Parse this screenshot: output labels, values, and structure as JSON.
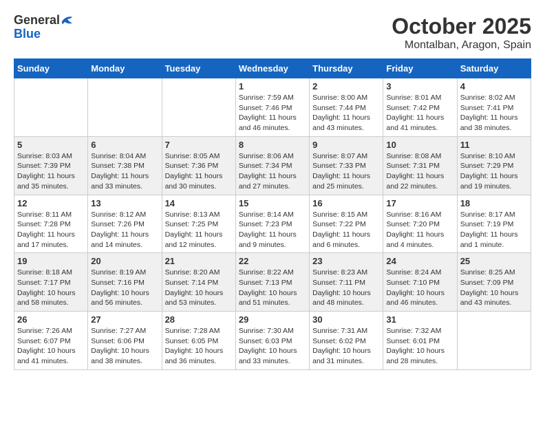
{
  "header": {
    "logo_line1": "General",
    "logo_line2": "Blue",
    "month": "October 2025",
    "location": "Montalban, Aragon, Spain"
  },
  "weekdays": [
    "Sunday",
    "Monday",
    "Tuesday",
    "Wednesday",
    "Thursday",
    "Friday",
    "Saturday"
  ],
  "weeks": [
    [
      {
        "day": "",
        "info": ""
      },
      {
        "day": "",
        "info": ""
      },
      {
        "day": "",
        "info": ""
      },
      {
        "day": "1",
        "info": "Sunrise: 7:59 AM\nSunset: 7:46 PM\nDaylight: 11 hours\nand 46 minutes."
      },
      {
        "day": "2",
        "info": "Sunrise: 8:00 AM\nSunset: 7:44 PM\nDaylight: 11 hours\nand 43 minutes."
      },
      {
        "day": "3",
        "info": "Sunrise: 8:01 AM\nSunset: 7:42 PM\nDaylight: 11 hours\nand 41 minutes."
      },
      {
        "day": "4",
        "info": "Sunrise: 8:02 AM\nSunset: 7:41 PM\nDaylight: 11 hours\nand 38 minutes."
      }
    ],
    [
      {
        "day": "5",
        "info": "Sunrise: 8:03 AM\nSunset: 7:39 PM\nDaylight: 11 hours\nand 35 minutes."
      },
      {
        "day": "6",
        "info": "Sunrise: 8:04 AM\nSunset: 7:38 PM\nDaylight: 11 hours\nand 33 minutes."
      },
      {
        "day": "7",
        "info": "Sunrise: 8:05 AM\nSunset: 7:36 PM\nDaylight: 11 hours\nand 30 minutes."
      },
      {
        "day": "8",
        "info": "Sunrise: 8:06 AM\nSunset: 7:34 PM\nDaylight: 11 hours\nand 27 minutes."
      },
      {
        "day": "9",
        "info": "Sunrise: 8:07 AM\nSunset: 7:33 PM\nDaylight: 11 hours\nand 25 minutes."
      },
      {
        "day": "10",
        "info": "Sunrise: 8:08 AM\nSunset: 7:31 PM\nDaylight: 11 hours\nand 22 minutes."
      },
      {
        "day": "11",
        "info": "Sunrise: 8:10 AM\nSunset: 7:29 PM\nDaylight: 11 hours\nand 19 minutes."
      }
    ],
    [
      {
        "day": "12",
        "info": "Sunrise: 8:11 AM\nSunset: 7:28 PM\nDaylight: 11 hours\nand 17 minutes."
      },
      {
        "day": "13",
        "info": "Sunrise: 8:12 AM\nSunset: 7:26 PM\nDaylight: 11 hours\nand 14 minutes."
      },
      {
        "day": "14",
        "info": "Sunrise: 8:13 AM\nSunset: 7:25 PM\nDaylight: 11 hours\nand 12 minutes."
      },
      {
        "day": "15",
        "info": "Sunrise: 8:14 AM\nSunset: 7:23 PM\nDaylight: 11 hours\nand 9 minutes."
      },
      {
        "day": "16",
        "info": "Sunrise: 8:15 AM\nSunset: 7:22 PM\nDaylight: 11 hours\nand 6 minutes."
      },
      {
        "day": "17",
        "info": "Sunrise: 8:16 AM\nSunset: 7:20 PM\nDaylight: 11 hours\nand 4 minutes."
      },
      {
        "day": "18",
        "info": "Sunrise: 8:17 AM\nSunset: 7:19 PM\nDaylight: 11 hours\nand 1 minute."
      }
    ],
    [
      {
        "day": "19",
        "info": "Sunrise: 8:18 AM\nSunset: 7:17 PM\nDaylight: 10 hours\nand 58 minutes."
      },
      {
        "day": "20",
        "info": "Sunrise: 8:19 AM\nSunset: 7:16 PM\nDaylight: 10 hours\nand 56 minutes."
      },
      {
        "day": "21",
        "info": "Sunrise: 8:20 AM\nSunset: 7:14 PM\nDaylight: 10 hours\nand 53 minutes."
      },
      {
        "day": "22",
        "info": "Sunrise: 8:22 AM\nSunset: 7:13 PM\nDaylight: 10 hours\nand 51 minutes."
      },
      {
        "day": "23",
        "info": "Sunrise: 8:23 AM\nSunset: 7:11 PM\nDaylight: 10 hours\nand 48 minutes."
      },
      {
        "day": "24",
        "info": "Sunrise: 8:24 AM\nSunset: 7:10 PM\nDaylight: 10 hours\nand 46 minutes."
      },
      {
        "day": "25",
        "info": "Sunrise: 8:25 AM\nSunset: 7:09 PM\nDaylight: 10 hours\nand 43 minutes."
      }
    ],
    [
      {
        "day": "26",
        "info": "Sunrise: 7:26 AM\nSunset: 6:07 PM\nDaylight: 10 hours\nand 41 minutes."
      },
      {
        "day": "27",
        "info": "Sunrise: 7:27 AM\nSunset: 6:06 PM\nDaylight: 10 hours\nand 38 minutes."
      },
      {
        "day": "28",
        "info": "Sunrise: 7:28 AM\nSunset: 6:05 PM\nDaylight: 10 hours\nand 36 minutes."
      },
      {
        "day": "29",
        "info": "Sunrise: 7:30 AM\nSunset: 6:03 PM\nDaylight: 10 hours\nand 33 minutes."
      },
      {
        "day": "30",
        "info": "Sunrise: 7:31 AM\nSunset: 6:02 PM\nDaylight: 10 hours\nand 31 minutes."
      },
      {
        "day": "31",
        "info": "Sunrise: 7:32 AM\nSunset: 6:01 PM\nDaylight: 10 hours\nand 28 minutes."
      },
      {
        "day": "",
        "info": ""
      }
    ]
  ],
  "colors": {
    "header_bg": "#1565c0",
    "row_alt": "#f0f0f0",
    "row_white": "#ffffff"
  }
}
